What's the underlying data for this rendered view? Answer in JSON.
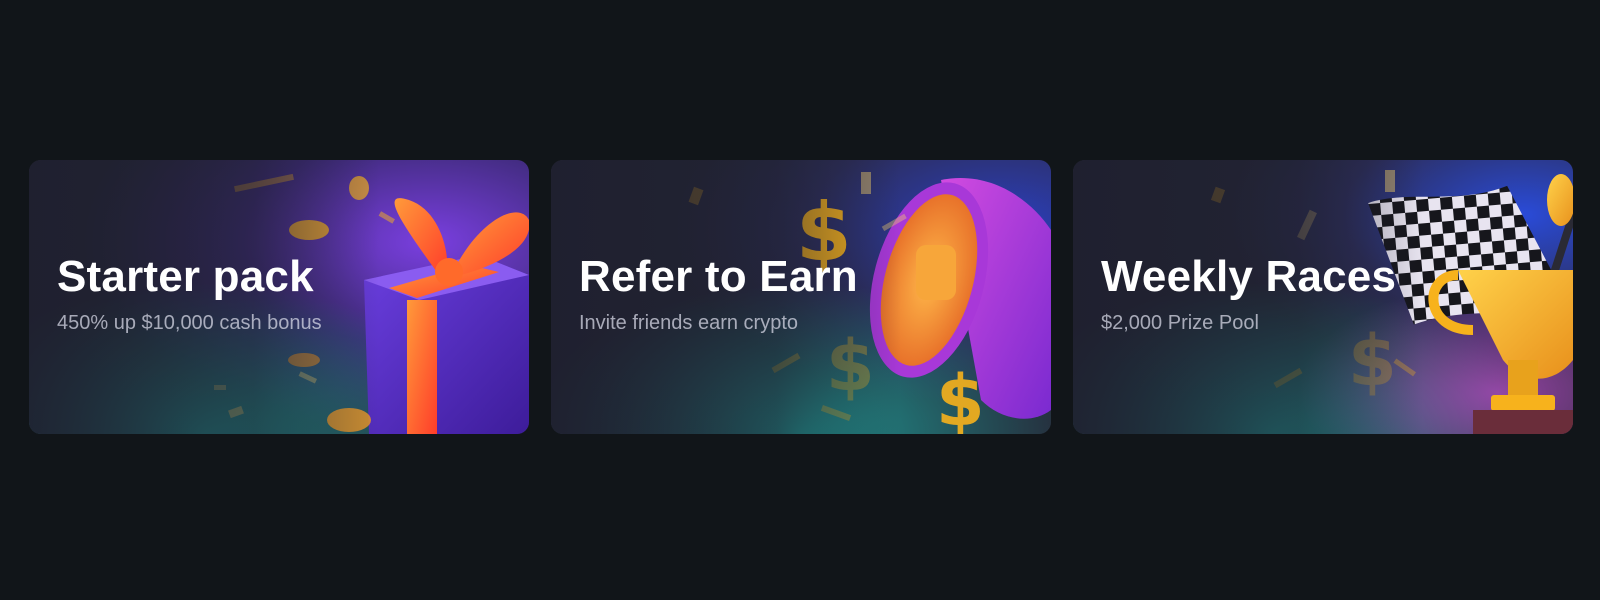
{
  "promotions": [
    {
      "title": "Starter pack",
      "subtitle": "450% up $10,000 cash bonus",
      "icon": "gift-box-icon"
    },
    {
      "title": "Refer to Earn",
      "subtitle": "Invite friends earn crypto",
      "icon": "megaphone-icon"
    },
    {
      "title": "Weekly Races",
      "subtitle": "$2,000 Prize Pool",
      "icon": "trophy-icon"
    }
  ],
  "colors": {
    "page_background": "#111519",
    "card_base": "#262838",
    "accent_purple": "#6a35d8",
    "accent_orange": "#ff7a1a",
    "accent_teal": "#1fa39b",
    "gold": "#f7b21c"
  }
}
